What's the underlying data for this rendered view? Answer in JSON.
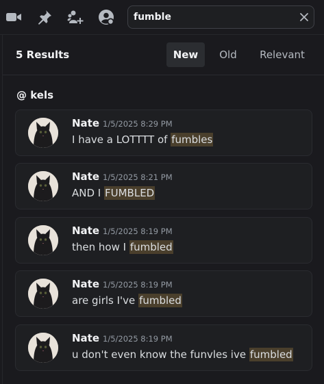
{
  "toolbar": {
    "icons": [
      "video-camera-icon",
      "pin-icon",
      "add-member-icon",
      "user-profile-icon"
    ]
  },
  "search": {
    "value": "fumble",
    "placeholder": "Search"
  },
  "results": {
    "count_label": "5 Results",
    "tabs": [
      {
        "label": "New",
        "active": true
      },
      {
        "label": "Old",
        "active": false
      },
      {
        "label": "Relevant",
        "active": false
      }
    ],
    "channel_label": "@ kels",
    "messages": [
      {
        "author": "Nate",
        "timestamp": "1/5/2025 8:29 PM",
        "before": "I have a LOTTTT of ",
        "highlight": "fumbles",
        "after": ""
      },
      {
        "author": "Nate",
        "timestamp": "1/5/2025 8:21 PM",
        "before": "AND I ",
        "highlight": "FUMBLED",
        "after": ""
      },
      {
        "author": "Nate",
        "timestamp": "1/5/2025 8:19 PM",
        "before": "then how I ",
        "highlight": "fumbled",
        "after": ""
      },
      {
        "author": "Nate",
        "timestamp": "1/5/2025 8:19 PM",
        "before": "are girls I've ",
        "highlight": "fumbled",
        "after": ""
      },
      {
        "author": "Nate",
        "timestamp": "1/5/2025 8:19 PM",
        "before": "u don't even know the funvles ive ",
        "highlight": "fumbled",
        "after": ""
      }
    ]
  },
  "colors": {
    "background": "#1a1a1e",
    "card": "#1e1f22",
    "highlight": "#4a3f2c",
    "timestamp": "#949ba4"
  }
}
